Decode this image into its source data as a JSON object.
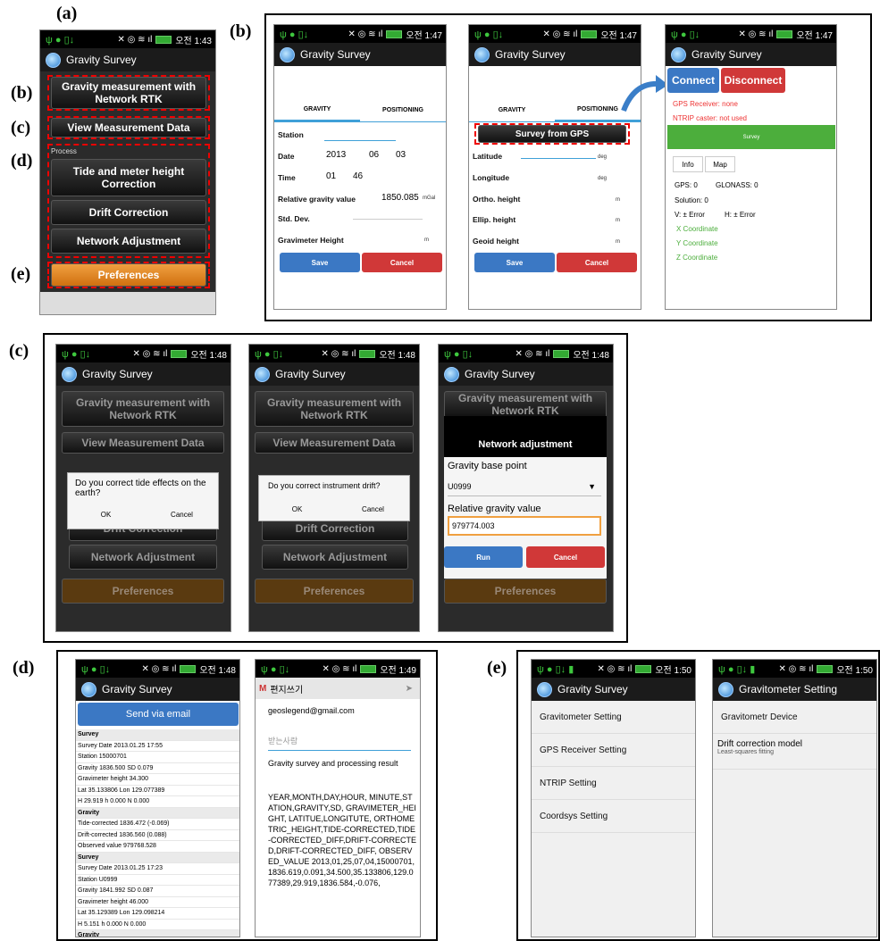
{
  "status": {
    "time_a": "오전 1:43",
    "time_b": "오전 1:47",
    "time_c": "오전 1:48",
    "time_d1": "오전 1:48",
    "time_d2": "오전 1:49",
    "time_e": "오전 1:50"
  },
  "labels": {
    "a": "(a)",
    "b": "(b)",
    "c": "(c)",
    "d": "(d)",
    "e": "(e)"
  },
  "app_title": "Gravity Survey",
  "main_menu": {
    "btn1": "Gravity measurement with Network RTK",
    "btn2": "View Measurement Data",
    "process": "Process",
    "btn3": "Tide and meter height Correction",
    "btn4": "Drift Correction",
    "btn5": "Network Adjustment",
    "btn6": "Preferences"
  },
  "tabs": {
    "gravity": "GRAVITY",
    "positioning": "POSITIONING"
  },
  "grav_form": {
    "station": "Station",
    "date": "Date",
    "year": "2013",
    "month": "06",
    "day": "03",
    "time": "Time",
    "hour": "01",
    "minute": "46",
    "rel": "Relative gravity value",
    "rel_val": "1850.085",
    "rel_unit": "mGal",
    "std": "Std. Dev.",
    "height": "Gravimeter Height",
    "height_unit": "m",
    "save": "Save",
    "cancel": "Cancel"
  },
  "pos_form": {
    "survey_gps": "Survey from GPS",
    "lat": "Latitude",
    "lon": "Longitude",
    "ortho": "Ortho. height",
    "ellip": "Ellip. height",
    "geoid": "Geoid height",
    "deg": "deg",
    "m": "m"
  },
  "gps": {
    "connect": "Connect",
    "disconnect": "Disconnect",
    "receiver": "GPS Receiver: none",
    "ntrip": "NTRIP caster: not used",
    "survey": "Survey",
    "tab_info": "Info",
    "tab_map": "Map",
    "gps_count": "GPS: 0",
    "glonass": "GLONASS: 0",
    "solution": "Solution: 0",
    "v": "V: ± Error",
    "h": "H: ± Error",
    "x": "X Coordinate",
    "y": "Y Coordinate",
    "z": "Z Coordinate"
  },
  "dialogs": {
    "tide_q": "Do you correct tide effects on the earth?",
    "drift_q": "Do you correct instrument drift?",
    "ok": "OK",
    "cancel": "Cancel",
    "net_title": "Network adjustment",
    "base": "Gravity base point",
    "base_val": "U0999",
    "rel": "Relative gravity value",
    "rel_val": "979774.003",
    "run": "Run"
  },
  "data_view": {
    "send": "Send via email",
    "rows": [
      "Survey",
      "Survey Date  2013.01.25 17:55",
      "Station  15000701",
      "Gravity  1836.500   SD 0.079",
      "Gravimeter height  34.300",
      "Lat  35.133806   Lon  129.077389",
      "H  29.919   h  0.000   N  0.000",
      "Gravity",
      "Tide-corrected  1836.472 (-0.069)",
      "Drift-corrected  1836.560 (0.088)",
      "Observed value  979768.528",
      "Survey",
      "Survey Date  2013.01.25 17:23",
      "Station  U0999",
      "Gravity  1841.992   SD 0.087",
      "Gravimeter height  46.000",
      "Lat  35.129389   Lon  129.098214",
      "H  5.151   h  0.000   N  0.000",
      "Gravity"
    ]
  },
  "email": {
    "header": "편지쓰기",
    "from": "geoslegend@gmail.com",
    "to": "받는사람",
    "subject": "Gravity survey and processing result",
    "body": "YEAR,MONTH,DAY,HOUR, MINUTE,STATION,GRAVITY,SD, GRAVIMETER_HEIGHT, LATITUE,LONGITUTE, ORTHOMETRIC_HEIGHT,TIDE-CORRECTED,TIDE-CORRECTED_DIFF,DRIFT-CORRECTED,DRIFT-CORRECTED_DIFF, OBSERVED_VALUE 2013,01,25,07,04,15000701,1836.619,0.091,34.500,35.133806,129.077389,29.919,1836.584,-0.076,"
  },
  "prefs": {
    "items": [
      "Gravitometer Setting",
      "GPS Receiver Setting",
      "NTRIP Setting",
      "Coordsys Setting"
    ],
    "grav_title": "Gravitometer Setting",
    "grav_device": "Gravitometr Device",
    "drift_model": "Drift correction model",
    "drift_sub": "Least-squares fitting"
  }
}
